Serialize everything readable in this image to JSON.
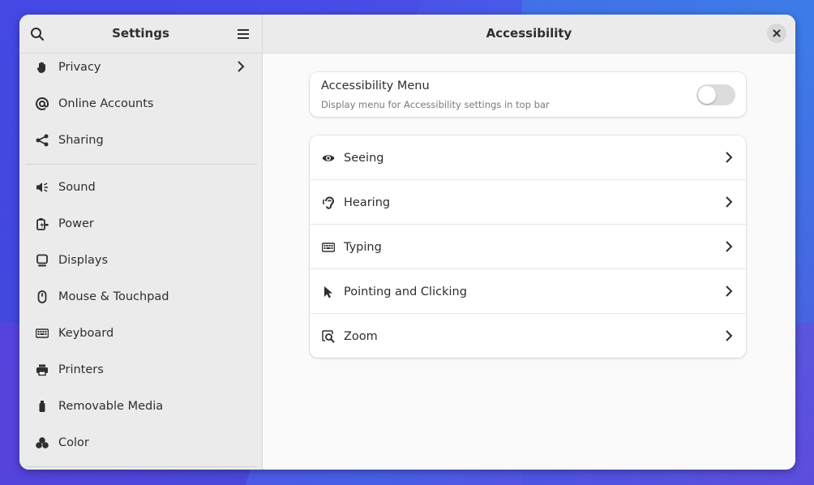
{
  "sidebar": {
    "title": "Settings",
    "items": [
      {
        "label": "Privacy",
        "icon": "hand-icon"
      },
      {
        "label": "Online Accounts",
        "icon": "at-icon"
      },
      {
        "label": "Sharing",
        "icon": "share-icon"
      },
      {
        "label": "Sound",
        "icon": "speaker-icon"
      },
      {
        "label": "Power",
        "icon": "power-icon"
      },
      {
        "label": "Displays",
        "icon": "display-icon"
      },
      {
        "label": "Mouse & Touchpad",
        "icon": "mouse-icon"
      },
      {
        "label": "Keyboard",
        "icon": "keyboard-icon"
      },
      {
        "label": "Printers",
        "icon": "printer-icon"
      },
      {
        "label": "Removable Media",
        "icon": "usb-icon"
      },
      {
        "label": "Color",
        "icon": "color-icon"
      }
    ]
  },
  "main": {
    "title": "Accessibility",
    "accessibility_menu": {
      "title": "Accessibility Menu",
      "subtitle": "Display menu for Accessibility settings in top bar",
      "enabled": false
    },
    "rows": [
      {
        "label": "Seeing",
        "icon": "eye-icon"
      },
      {
        "label": "Hearing",
        "icon": "ear-icon"
      },
      {
        "label": "Typing",
        "icon": "keyboard-icon"
      },
      {
        "label": "Pointing and Clicking",
        "icon": "pointer-icon"
      },
      {
        "label": "Zoom",
        "icon": "zoom-icon"
      }
    ]
  },
  "colors": {
    "window_bg": "#fafafa",
    "sidebar_bg": "#ebebeb",
    "text": "#2e2e2e",
    "switch_off": "#dcdcdc"
  }
}
